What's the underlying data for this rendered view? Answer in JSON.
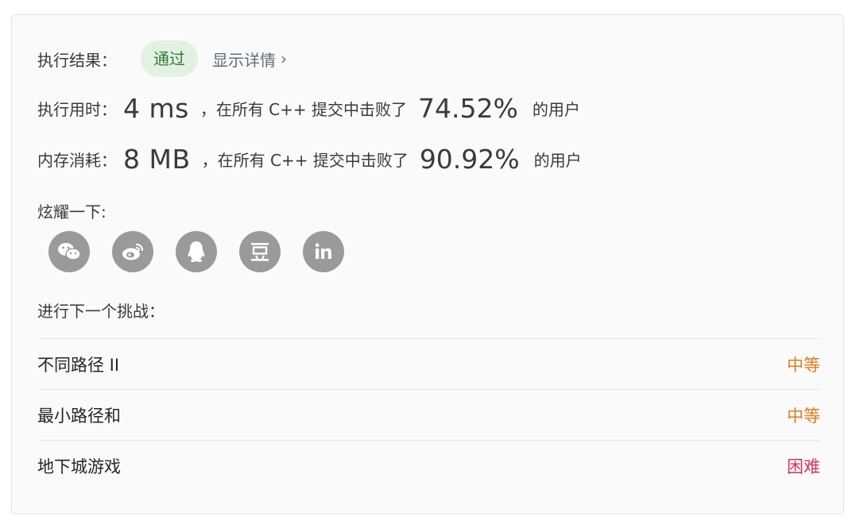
{
  "result": {
    "label": "执行结果：",
    "status": "通过",
    "details_link": "显示详情",
    "details_chevron": "›"
  },
  "runtime": {
    "label": "执行用时：",
    "value": "4 ms",
    "text_before": "，在所有 C++ 提交中击败了",
    "percent": "74.52%",
    "text_after": "的用户"
  },
  "memory": {
    "label": "内存消耗：",
    "value": "8 MB",
    "text_before": "，在所有 C++ 提交中击败了",
    "percent": "90.92%",
    "text_after": "的用户"
  },
  "share": {
    "label": "炫耀一下:",
    "icons": [
      "wechat-icon",
      "weibo-icon",
      "qq-icon",
      "douban-icon",
      "linkedin-icon"
    ],
    "icon_color": "#9a9a9a"
  },
  "next_challenge": {
    "label": "进行下一个挑战：",
    "items": [
      {
        "title": "不同路径 II",
        "difficulty": "中等",
        "difficulty_color": "#e07b1e"
      },
      {
        "title": "最小路径和",
        "difficulty": "中等",
        "difficulty_color": "#e07b1e"
      },
      {
        "title": "地下城游戏",
        "difficulty": "困难",
        "difficulty_color": "#d3345a"
      }
    ]
  },
  "colors": {
    "pass_badge_bg": "#e3f1e3",
    "pass_badge_text": "#2e7d32",
    "link": "#5f6f7b"
  }
}
